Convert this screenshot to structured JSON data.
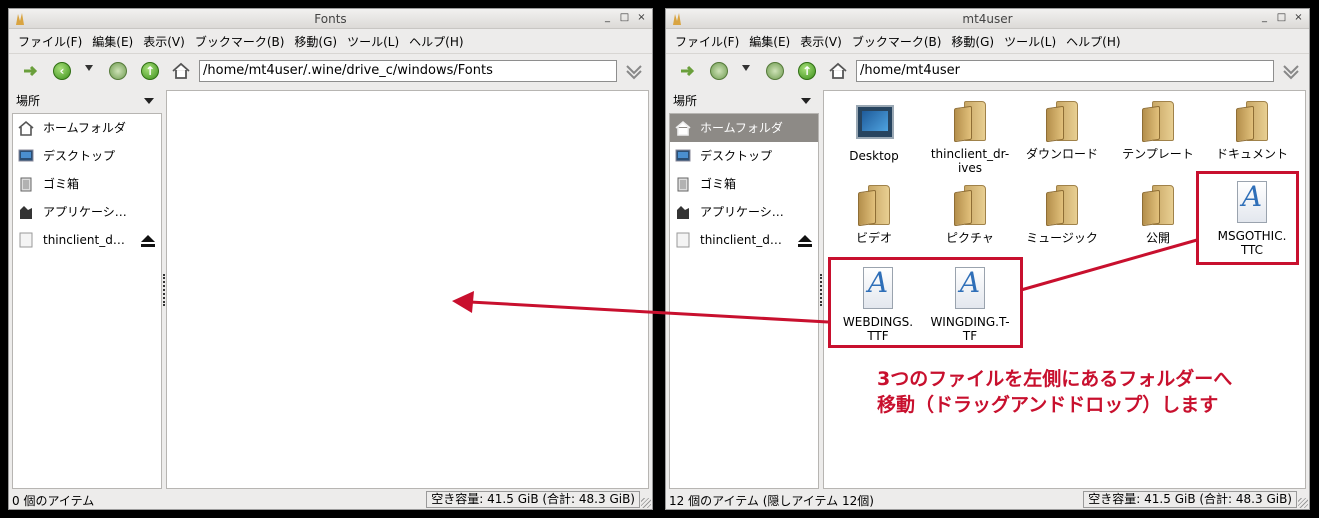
{
  "colors": {
    "accent_red": "#c8102e",
    "selection_gray": "#8d8a86",
    "folder_tan": "#d9b871"
  },
  "menu": [
    "ファイル(F)",
    "編集(E)",
    "表示(V)",
    "ブックマーク(B)",
    "移動(G)",
    "ツール(L)",
    "ヘルプ(H)"
  ],
  "sidebar": {
    "header": "場所",
    "items": [
      {
        "label": "ホームフォルダ",
        "icon": "home-icon"
      },
      {
        "label": "デスクトップ",
        "icon": "desktop-icon"
      },
      {
        "label": "ゴミ箱",
        "icon": "trash-icon"
      },
      {
        "label": "アプリケーシ…",
        "icon": "applications-icon"
      },
      {
        "label": "thinclient_d…",
        "icon": "drive-icon"
      }
    ]
  },
  "left_window": {
    "title": "Fonts",
    "path": "/home/mt4user/.wine/drive_c/windows/Fonts",
    "status_left": "0 個のアイテム",
    "status_right": "空き容量: 41.5 GiB (合計: 48.3 GiB)"
  },
  "right_window": {
    "title": "mt4user",
    "path": "/home/mt4user",
    "status_left": "12 個のアイテム (隠しアイテム 12個)",
    "status_right": "空き容量: 41.5 GiB (合計: 48.3 GiB)",
    "files": [
      {
        "label": "Desktop",
        "icon": "desktop-icon"
      },
      {
        "label": "thinclient_dr-ives",
        "icon": "folder-icon"
      },
      {
        "label": "ダウンロード",
        "icon": "folder-icon"
      },
      {
        "label": "テンプレート",
        "icon": "folder-icon"
      },
      {
        "label": "ドキュメント",
        "icon": "folder-icon"
      },
      {
        "label": "ビデオ",
        "icon": "folder-icon"
      },
      {
        "label": "ピクチャ",
        "icon": "folder-icon"
      },
      {
        "label": "ミュージック",
        "icon": "folder-icon"
      },
      {
        "label": "公開",
        "icon": "folder-icon"
      },
      {
        "label": "MSGOTHIC.TTC",
        "icon": "font-file-icon"
      },
      {
        "label": "WEBDINGS.TTF",
        "icon": "font-file-icon"
      },
      {
        "label": "WINGDING.T-TF",
        "icon": "font-file-icon"
      }
    ]
  },
  "annotation": {
    "line1": "3つのファイルを左側にあるフォルダーへ",
    "line2": "移動（ドラッグアンドドロップ）します"
  }
}
